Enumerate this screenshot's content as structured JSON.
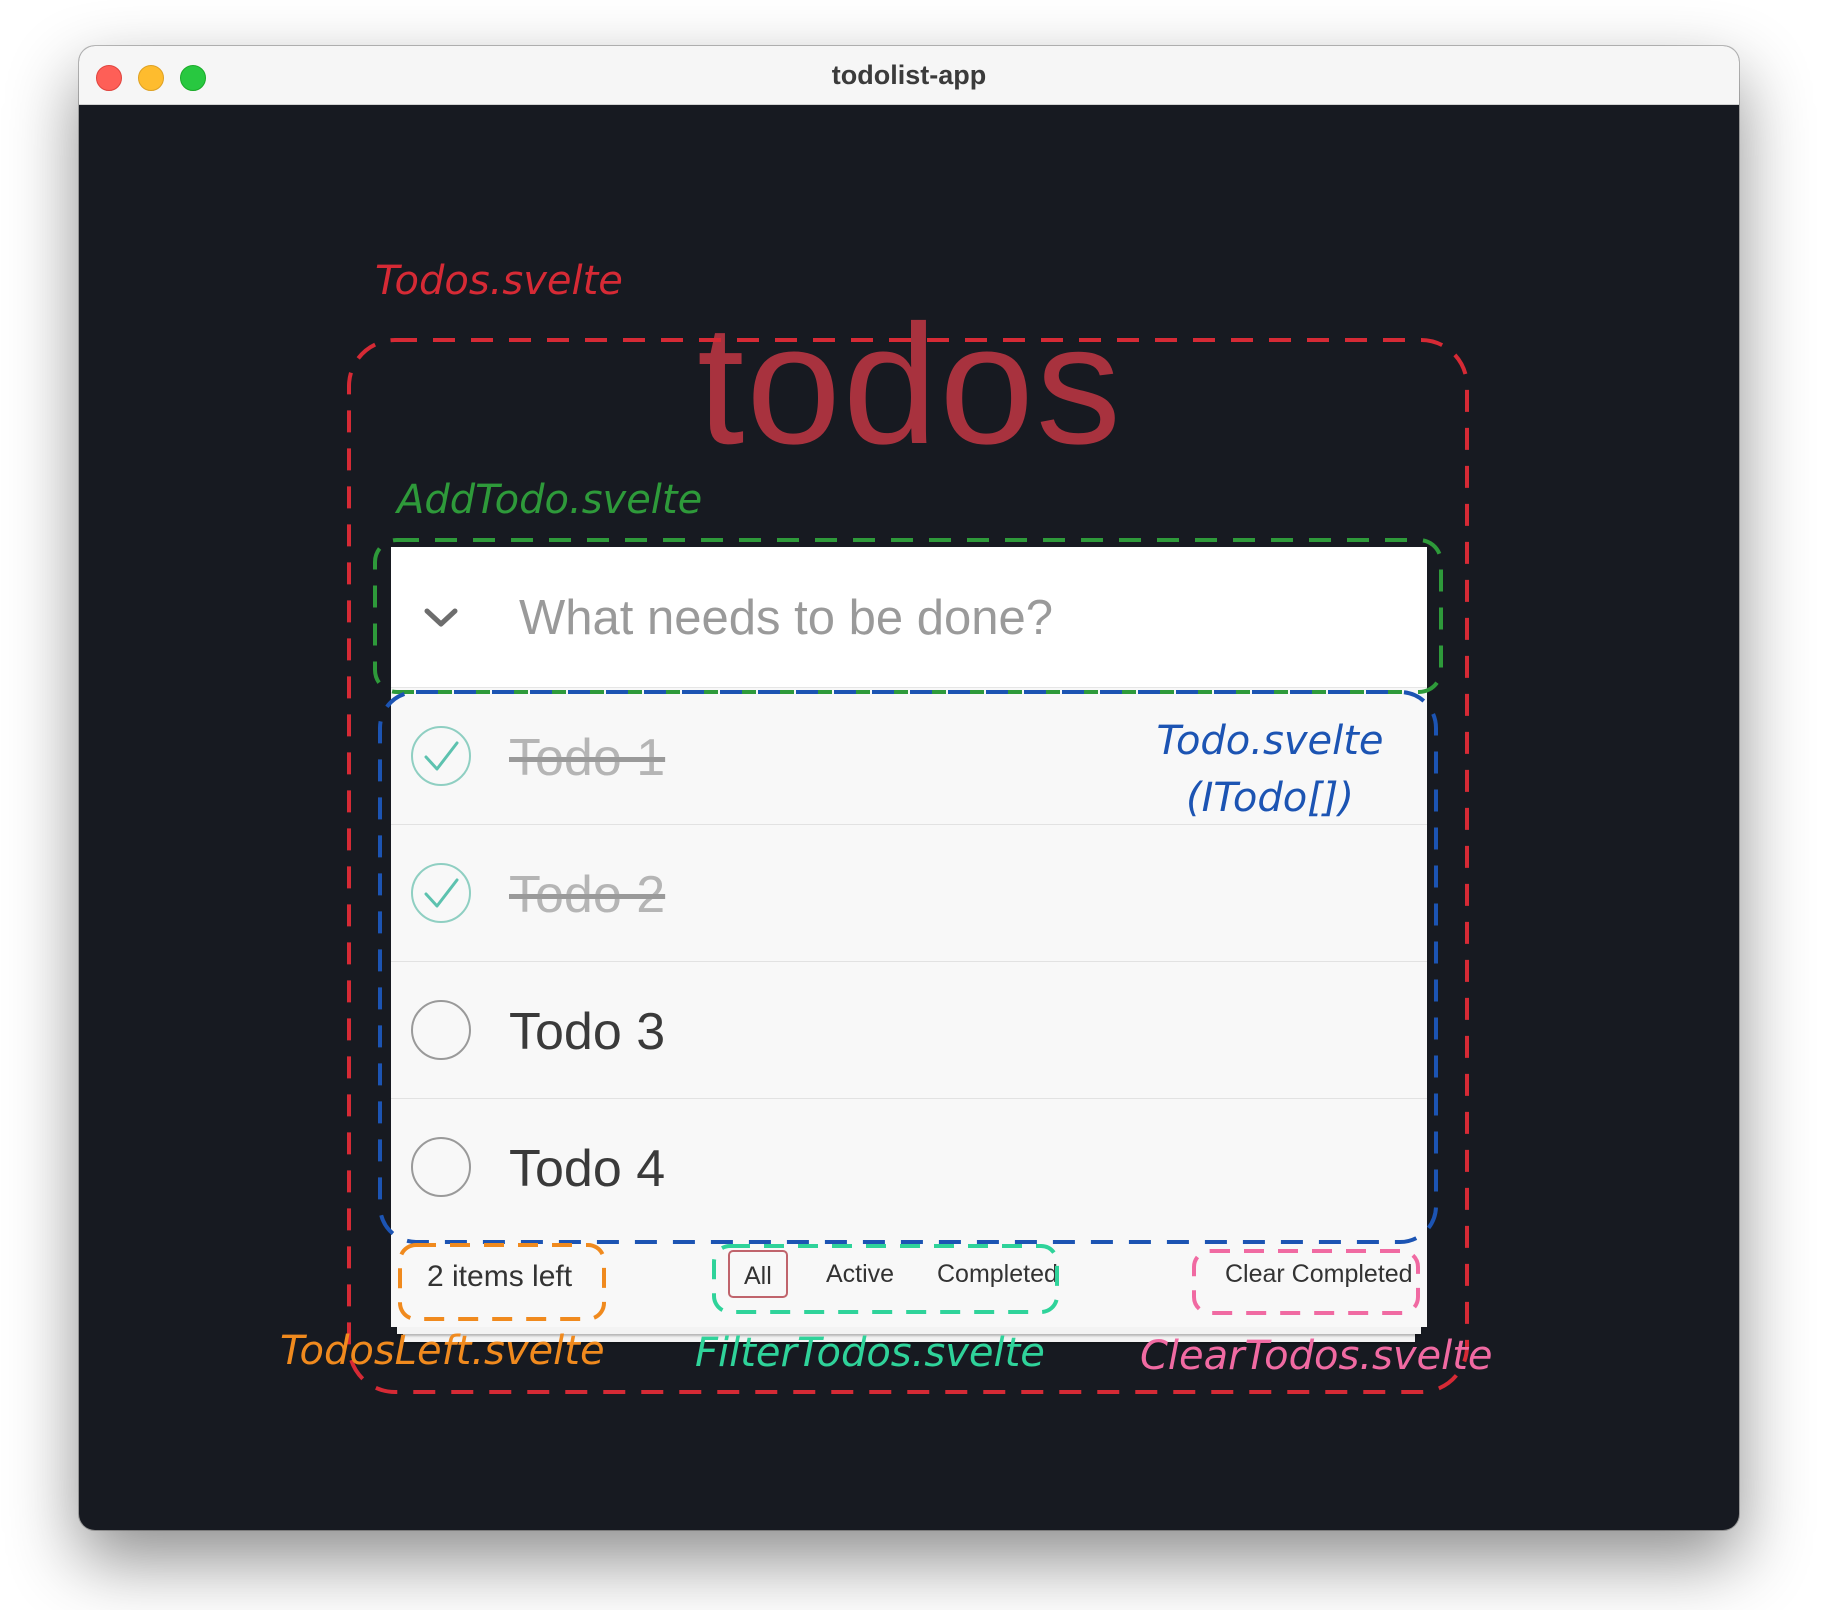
{
  "window": {
    "title": "todolist-app",
    "controls": [
      "close",
      "minimize",
      "maximize"
    ]
  },
  "app": {
    "heading": "todos",
    "new_todo": {
      "placeholder": "What needs to be done?",
      "value": "",
      "toggle_icon": "chevron-down-icon"
    },
    "todos": [
      {
        "label": "Todo 1",
        "completed": true
      },
      {
        "label": "Todo 2",
        "completed": true
      },
      {
        "label": "Todo 3",
        "completed": false
      },
      {
        "label": "Todo 4",
        "completed": false
      }
    ],
    "footer": {
      "items_left": "2 items left",
      "filters": [
        {
          "label": "All",
          "selected": true
        },
        {
          "label": "Active",
          "selected": false
        },
        {
          "label": "Completed",
          "selected": false
        }
      ],
      "clear_completed": "Clear Completed"
    }
  },
  "annotations": {
    "todos_component": {
      "text": "Todos.svelte",
      "color": "#d62a35"
    },
    "add_todo_component": {
      "text": "AddTodo.svelte",
      "color": "#2e9a3a"
    },
    "todo_component": {
      "text": "Todo.svelte",
      "subtext": "(ITodo[])",
      "color": "#1c54b3"
    },
    "todos_left_component": {
      "text": "TodosLeft.svelte",
      "color": "#f08a1e"
    },
    "filter_todos_component": {
      "text": "FilterTodos.svelte",
      "color": "#2fd39a"
    },
    "clear_todos_component": {
      "text": "ClearTodos.svelte",
      "color": "#f06aa2"
    }
  },
  "colors": {
    "window_bg": "#171a21",
    "heading": "#a8323e",
    "check_green": "#5dc2af",
    "filter_selected_border": "#c0646c"
  }
}
